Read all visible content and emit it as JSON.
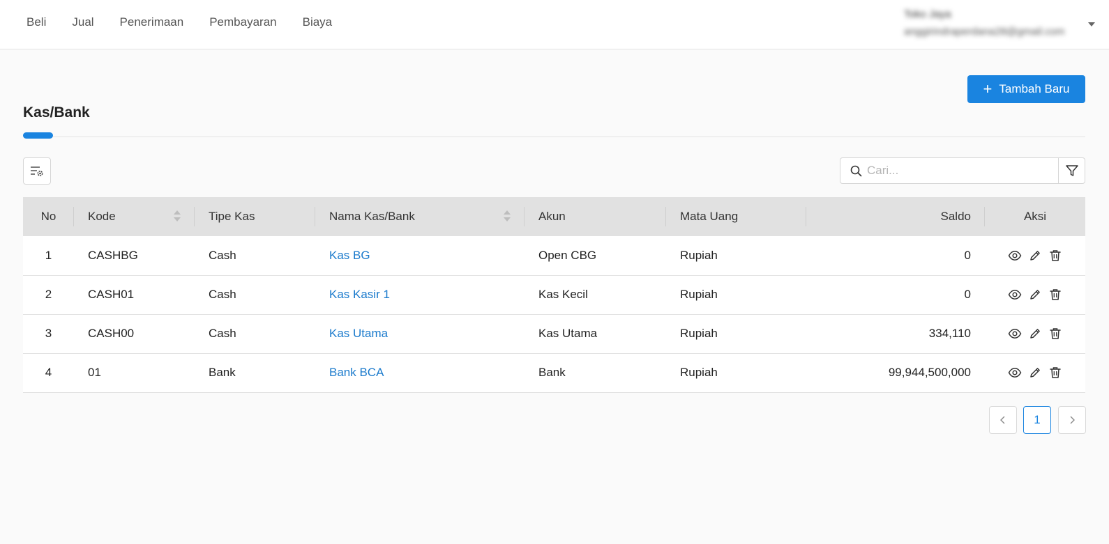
{
  "nav": {
    "items": [
      {
        "label": "Beli"
      },
      {
        "label": "Jual"
      },
      {
        "label": "Penerimaan"
      },
      {
        "label": "Pembayaran"
      },
      {
        "label": "Biaya"
      }
    ]
  },
  "user": {
    "name": "Toko Jaya",
    "email": "anggirindraperdana28@gmail.com"
  },
  "page": {
    "title": "Kas/Bank",
    "add_label": "Tambah Baru"
  },
  "search": {
    "placeholder": "Cari..."
  },
  "table": {
    "headers": {
      "no": "No",
      "kode": "Kode",
      "tipe": "Tipe Kas",
      "nama": "Nama Kas/Bank",
      "akun": "Akun",
      "mata_uang": "Mata Uang",
      "saldo": "Saldo",
      "aksi": "Aksi"
    },
    "rows": [
      {
        "no": "1",
        "kode": "CASHBG",
        "tipe": "Cash",
        "nama": "Kas BG",
        "akun": "Open CBG",
        "mata_uang": "Rupiah",
        "saldo": "0"
      },
      {
        "no": "2",
        "kode": "CASH01",
        "tipe": "Cash",
        "nama": "Kas Kasir 1",
        "akun": "Kas Kecil",
        "mata_uang": "Rupiah",
        "saldo": "0"
      },
      {
        "no": "3",
        "kode": "CASH00",
        "tipe": "Cash",
        "nama": "Kas Utama",
        "akun": "Kas Utama",
        "mata_uang": "Rupiah",
        "saldo": "334,110"
      },
      {
        "no": "4",
        "kode": "01",
        "tipe": "Bank",
        "nama": "Bank BCA",
        "akun": "Bank",
        "mata_uang": "Rupiah",
        "saldo": "99,944,500,000"
      }
    ]
  },
  "pagination": {
    "current": "1"
  },
  "colors": {
    "accent": "#1a84e0",
    "link": "#1a7acc",
    "header_bg": "#e1e1e1"
  }
}
